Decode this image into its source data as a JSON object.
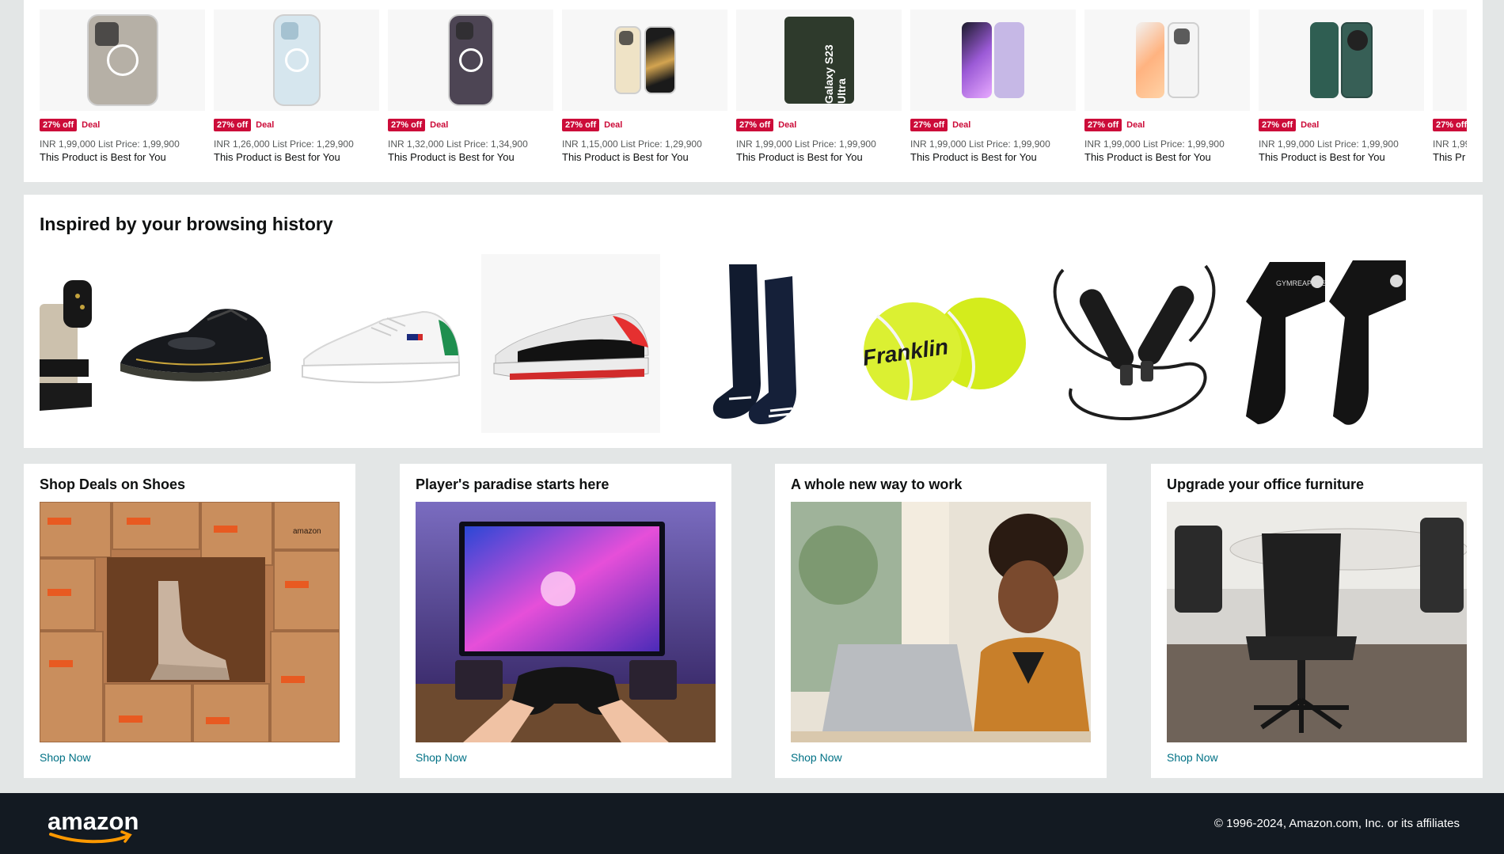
{
  "deals": {
    "items": [
      {
        "discount": "27% off",
        "deal_label": "Deal",
        "price_line": "INR 1,99,000 List Price: 1,99,900",
        "tagline": "This Product is Best for You",
        "icon": "iphone-natural-titanium"
      },
      {
        "discount": "27% off",
        "deal_label": "Deal",
        "price_line": "INR 1,26,000 List Price: 1,29,900",
        "tagline": "This Product is Best for You",
        "icon": "iphone-blue"
      },
      {
        "discount": "27% off",
        "deal_label": "Deal",
        "price_line": "INR 1,32,000 List Price: 1,34,900",
        "tagline": "This Product is Best for You",
        "icon": "iphone-purple"
      },
      {
        "discount": "27% off",
        "deal_label": "Deal",
        "price_line": "INR 1,15,000 List Price: 1,29,900",
        "tagline": "This Product is Best for You",
        "icon": "iphone-gold"
      },
      {
        "discount": "27% off",
        "deal_label": "Deal",
        "price_line": "INR 1,99,000 List Price: 1,99,900",
        "tagline": "This Product is Best for You",
        "icon": "galaxy-s23-ultra",
        "printed_text": "Galaxy S23 Ultra"
      },
      {
        "discount": "27% off",
        "deal_label": "Deal",
        "price_line": "INR 1,99,000 List Price: 1,99,900",
        "tagline": "This Product is Best for You",
        "icon": "flip-phone-purple"
      },
      {
        "discount": "27% off",
        "deal_label": "Deal",
        "price_line": "INR 1,99,000 List Price: 1,99,900",
        "tagline": "This Product is Best for You",
        "icon": "oppo-white"
      },
      {
        "discount": "27% off",
        "deal_label": "Deal",
        "price_line": "INR 1,99,000 List Price: 1,99,900",
        "tagline": "This Product is Best for You",
        "icon": "oneplus-green"
      },
      {
        "discount": "27% off",
        "deal_label": "",
        "price_line": "INR 1,99",
        "tagline": "This Pr",
        "icon": "phone-partial"
      }
    ]
  },
  "history": {
    "title": "Inspired by your browsing history",
    "items": [
      "sandal-icon",
      "patent-shoe-icon",
      "white-sneaker-icon",
      "puma-sneaker-icon",
      "socks-icon",
      "tennis-balls-icon",
      "jump-rope-icon",
      "lifting-straps-icon"
    ],
    "tennis_brand": "Franklin",
    "strap_brand": "GYMREAPERS"
  },
  "cards": [
    {
      "title": "Shop Deals on Shoes",
      "link": "Shop Now",
      "box_text": "amazon"
    },
    {
      "title": "Player's paradise starts here",
      "link": "Shop Now"
    },
    {
      "title": "A whole new way to work",
      "link": "Shop Now"
    },
    {
      "title": "Upgrade your office furniture",
      "link": "Shop Now"
    }
  ],
  "footer": {
    "logo_text": "amazon",
    "copyright": "© 1996-2024, Amazon.com, Inc. or its affiliates"
  },
  "colors": {
    "deal_red": "#cc0c39",
    "link_teal": "#007185",
    "footer_bg": "#131a22",
    "page_bg": "#e3e6e6"
  }
}
